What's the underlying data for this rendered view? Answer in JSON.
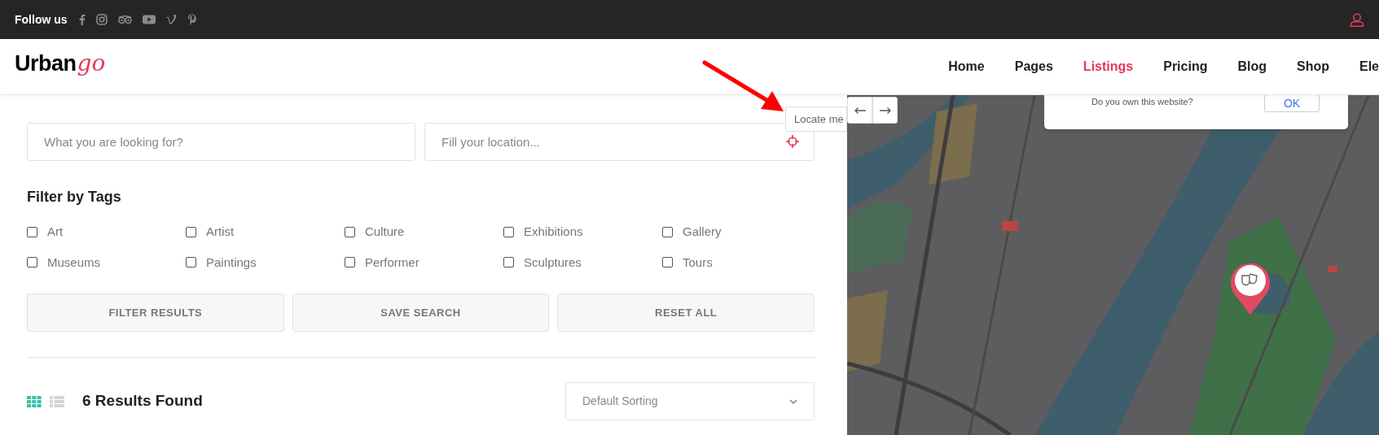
{
  "top_bar": {
    "label": "Follow us"
  },
  "header": {
    "logo": {
      "text": "Urban",
      "script": "go"
    },
    "nav": [
      {
        "label": "Home",
        "selected": false
      },
      {
        "label": "Pages",
        "selected": false
      },
      {
        "label": "Listings",
        "selected": true
      },
      {
        "label": "Pricing",
        "selected": false
      },
      {
        "label": "Blog",
        "selected": false
      },
      {
        "label": "Shop",
        "selected": false
      },
      {
        "label": "Ele",
        "selected": false
      }
    ]
  },
  "search": {
    "keyword_placeholder": "What you are looking for?",
    "location_placeholder": "Fill your location...",
    "locate_tooltip": "Locate me"
  },
  "filter": {
    "title": "Filter by Tags",
    "tags": [
      {
        "label": "Art",
        "checked": false
      },
      {
        "label": "Artist",
        "checked": false
      },
      {
        "label": "Culture",
        "checked": false
      },
      {
        "label": "Exhibitions",
        "checked": false
      },
      {
        "label": "Gallery",
        "checked": false
      },
      {
        "label": "Museums",
        "checked": false
      },
      {
        "label": "Paintings",
        "checked": false
      },
      {
        "label": "Performer",
        "checked": false
      },
      {
        "label": "Sculptures",
        "checked": false
      },
      {
        "label": "Tours",
        "checked": false
      }
    ]
  },
  "buttons": [
    "FILTER RESULTS",
    "SAVE SEARCH",
    "RESET ALL"
  ],
  "results": {
    "views": [
      {
        "kind": "grid",
        "selected": true
      },
      {
        "kind": "list",
        "selected": false
      }
    ],
    "count": "6 Results Found",
    "sort": {
      "value": "Default Sorting"
    }
  },
  "map": {
    "dialog": {
      "text": "Do you own this website?",
      "button": "OK"
    }
  }
}
